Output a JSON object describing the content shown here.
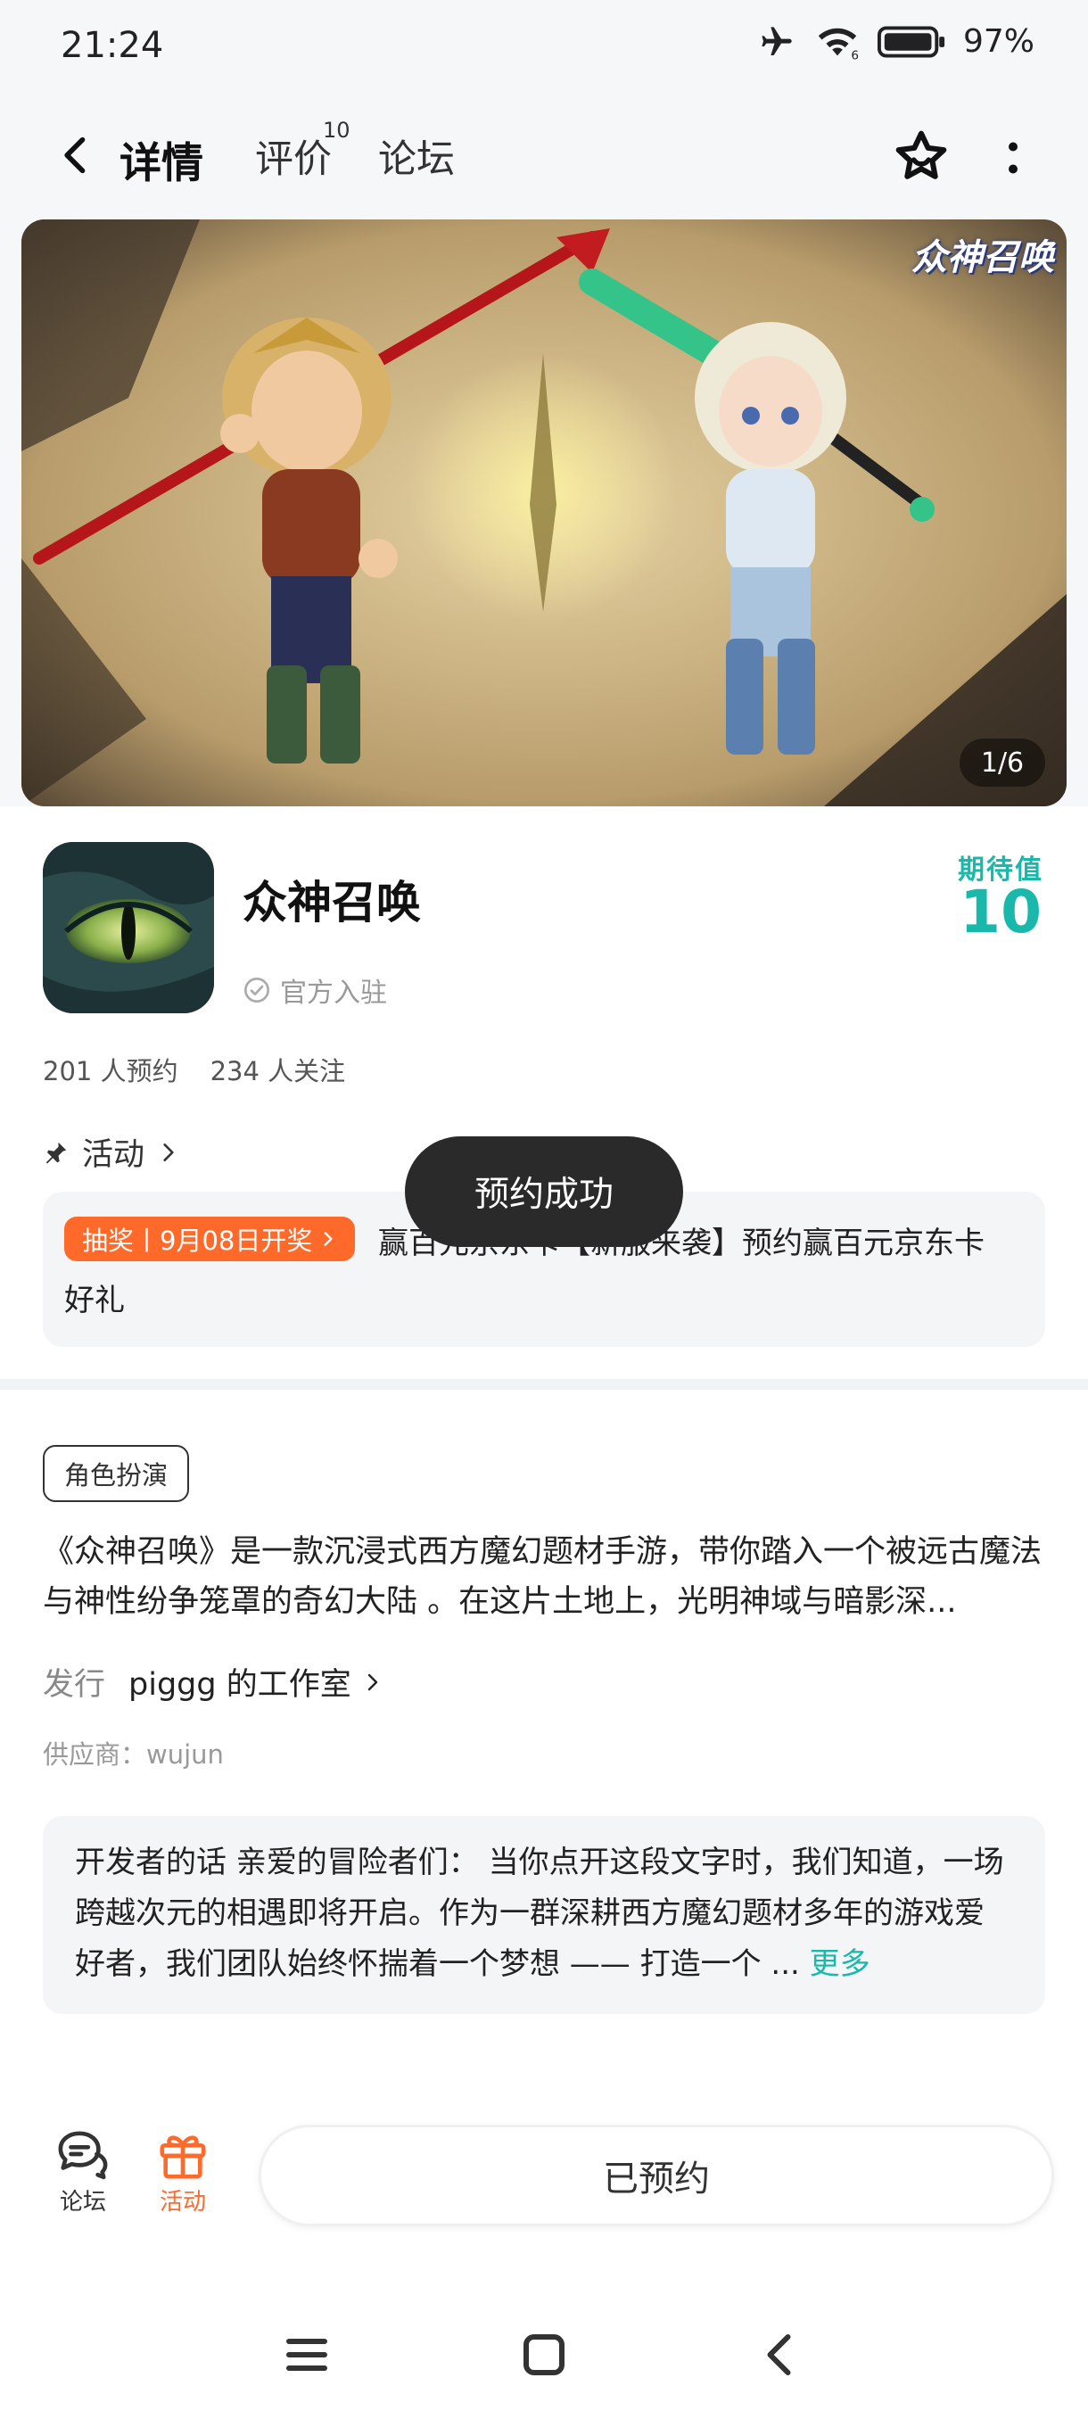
{
  "status": {
    "time": "21:24",
    "battery": "97%"
  },
  "nav": {
    "tabs": [
      {
        "label": "详情",
        "active": true
      },
      {
        "label": "评价",
        "badge": "10"
      },
      {
        "label": "论坛"
      }
    ]
  },
  "banner": {
    "counter": "1/6",
    "logo_text": "众神召唤"
  },
  "app": {
    "name": "众神召唤",
    "official": "官方入驻",
    "expectation_label": "期待值",
    "expectation_value": "10",
    "reservations": "201 人预约",
    "follows": "234 人关注"
  },
  "activity": {
    "header": "活动",
    "badge": "抽奖丨9月08日开奖",
    "text": "赢百元京东卡【新服来袭】预约赢百元京东卡好礼"
  },
  "toast": "预约成功",
  "details": {
    "genre": "角色扮演",
    "description": "《众神召唤》是一款沉浸式西方魔幻题材手游，带你踏入一个被远古魔法与神性纷争笼罩的奇幻大陆 。在这片土地上，光明神域与暗影深...",
    "publisher_label": "发行",
    "publisher": "piggg 的工作室",
    "supplier": "供应商：wujun",
    "dev_note": "开发者的话  亲爱的冒险者们：  当你点开这段文字时，我们知道，一场跨越次元的相遇即将开启。作为一群深耕西方魔幻题材多年的游戏爱好者，我们团队始终怀揣着一个梦想 —— 打造一个 ...",
    "more": "更多"
  },
  "bottom": {
    "forum": "论坛",
    "activity": "活动",
    "reserved": "已预约"
  },
  "colors": {
    "accent": "#19b8aa",
    "orange": "#ff6a2b"
  }
}
